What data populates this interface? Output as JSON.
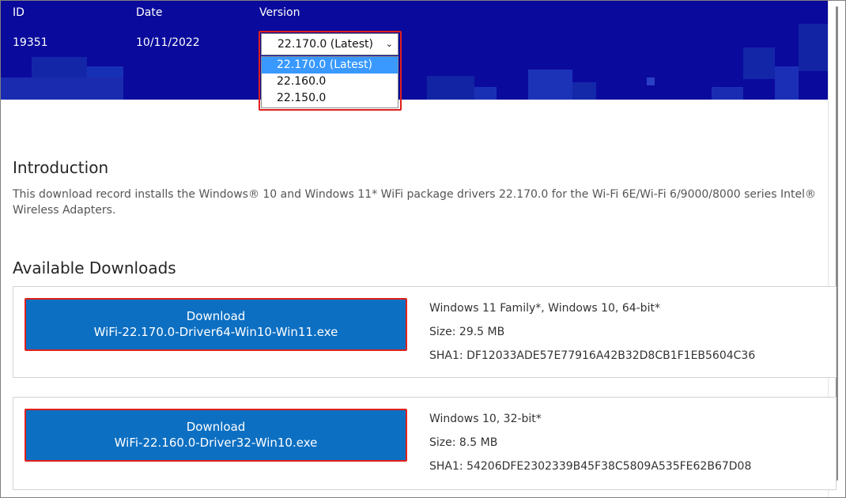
{
  "table": {
    "headers": {
      "id": "ID",
      "date": "Date",
      "version": "Version"
    },
    "row": {
      "id": "19351",
      "date": "10/11/2022"
    }
  },
  "version_select": {
    "selected": "22.170.0 (Latest)",
    "options": [
      "22.170.0 (Latest)",
      "22.160.0",
      "22.150.0"
    ]
  },
  "introduction": {
    "title": "Introduction",
    "text": "This download record installs the Windows® 10 and Windows 11* WiFi package drivers 22.170.0 for the Wi-Fi 6E/Wi-Fi 6/9000/8000 series Intel® Wireless Adapters."
  },
  "downloads": {
    "title": "Available Downloads",
    "items": [
      {
        "button_line1": "Download",
        "button_line2": "WiFi-22.170.0-Driver64-Win10-Win11.exe",
        "os": "Windows 11 Family*, Windows 10, 64-bit*",
        "size": "Size: 29.5 MB",
        "sha1": "SHA1: DF12033ADE57E77916A42B32D8CB1F1EB5604C36"
      },
      {
        "button_line1": "Download",
        "button_line2": "WiFi-22.160.0-Driver32-Win10.exe",
        "os": "Windows 10, 32-bit*",
        "size": "Size: 8.5 MB",
        "sha1": "SHA1: 54206DFE2302339B45F38C5809A535FE62B67D08"
      }
    ]
  },
  "colors": {
    "header_bg": "#0a0a9c",
    "button_bg": "#0c6fc2",
    "highlight": "#e0201b",
    "selected_option": "#3999ff"
  }
}
